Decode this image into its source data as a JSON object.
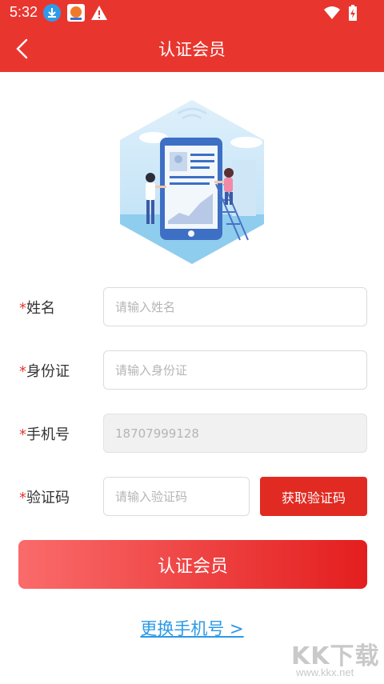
{
  "status_bar": {
    "time": "5:32"
  },
  "app_bar": {
    "title": "认证会员"
  },
  "form": {
    "required_mark": "*",
    "name": {
      "label": "姓名",
      "placeholder": "请输入姓名",
      "value": ""
    },
    "id_card": {
      "label": "身份证",
      "placeholder": "请输入身份证",
      "value": ""
    },
    "phone": {
      "label": "手机号",
      "value": "18707999128",
      "disabled": true
    },
    "verify_code": {
      "label": "验证码",
      "placeholder": "请输入验证码",
      "value": "",
      "button_label": "获取验证码"
    }
  },
  "submit": {
    "label": "认证会员"
  },
  "change_phone": {
    "label": "更换手机号 >"
  },
  "watermark": {
    "text": "KK下载",
    "url": "www.kkx.net"
  },
  "colors": {
    "primary": "#e8362f",
    "link": "#2b99e6"
  }
}
